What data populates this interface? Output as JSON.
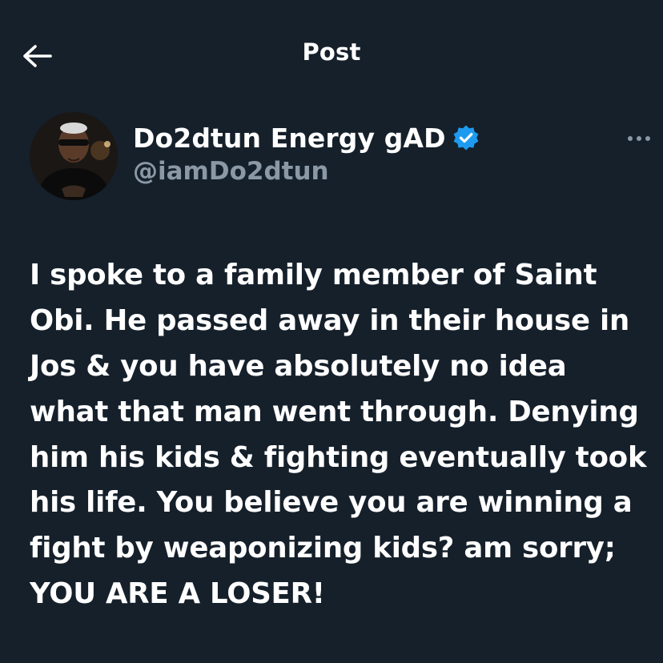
{
  "header": {
    "title": "Post",
    "back_icon": "arrow-left-icon"
  },
  "author": {
    "display_name": "Do2dtun Energy gAD",
    "handle": "@iamDo2dtun",
    "verified_icon": "verified-badge-icon",
    "verified_color": "#1d9bf0"
  },
  "post": {
    "lines": [
      "I spoke to a family member of Saint",
      "Obi. He passed away in their house in",
      "Jos & you have absolutely no idea",
      "what that man went through. Denying",
      "him his kids & fighting eventually took",
      "his life. You believe you are winning a",
      "fight by weaponizing kids? am sorry;",
      "YOU ARE A LOSER!"
    ]
  },
  "more_icon": "more-horizontal-icon",
  "colors": {
    "background": "#15202b",
    "text": "#ffffff",
    "secondary_text": "#8b98a5",
    "accent": "#1d9bf0"
  }
}
